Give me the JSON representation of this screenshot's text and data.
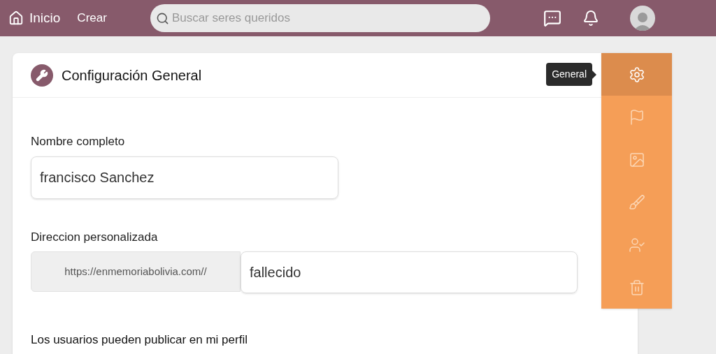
{
  "topbar": {
    "home": "Inicio",
    "create": "Crear",
    "search": {
      "placeholder": "Buscar seres queridos"
    }
  },
  "card": {
    "title": "Configuración General",
    "fields": [
      {
        "label": "Nombre completo",
        "value": "francisco Sanchez"
      },
      {
        "label": "Direccion personalizada",
        "prefix": "https://enmemoriabolivia.com//",
        "value": "fallecido"
      }
    ],
    "section": "Los usuarios pueden publicar en mi perfil"
  },
  "side_menu": [
    {
      "kind": "settings",
      "selected": true,
      "tooltip": "General"
    },
    {
      "kind": "flag",
      "selected": false
    },
    {
      "kind": "image",
      "selected": false
    },
    {
      "kind": "brush",
      "selected": false
    },
    {
      "kind": "user-check",
      "selected": false
    },
    {
      "kind": "trash",
      "selected": false
    }
  ]
}
